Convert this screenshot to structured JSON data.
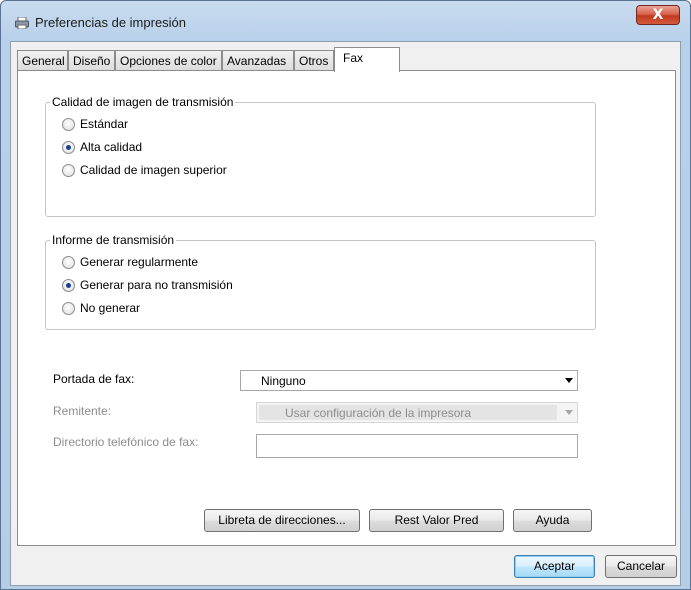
{
  "window": {
    "title": "Preferencias de impresión",
    "close_glyph": "X"
  },
  "tabs": [
    {
      "label": "General"
    },
    {
      "label": "Diseño"
    },
    {
      "label": "Opciones de color"
    },
    {
      "label": "Avanzadas"
    },
    {
      "label": "Otros"
    },
    {
      "label": "Fax"
    }
  ],
  "active_tab": "Fax",
  "quality": {
    "legend": "Calidad de imagen de transmisión",
    "options": [
      {
        "label": "Estándar",
        "checked": false
      },
      {
        "label": "Alta calidad",
        "checked": true
      },
      {
        "label": "Calidad de imagen superior",
        "checked": false
      }
    ]
  },
  "report": {
    "legend": "Informe de transmisión",
    "options": [
      {
        "label": "Generar regularmente",
        "checked": false
      },
      {
        "label": "Generar para no transmisión",
        "checked": true
      },
      {
        "label": "No generar",
        "checked": false
      }
    ]
  },
  "cover": {
    "label": "Portada de fax:",
    "value": "Ninguno"
  },
  "sender": {
    "label": "Remitente:",
    "value": "Usar configuración de la impresora",
    "enabled": false
  },
  "phonebook": {
    "label": "Directorio telefónico de fax:",
    "value": ""
  },
  "buttons": {
    "address_book": "Libreta de direcciones...",
    "reset": "Rest Valor Pred",
    "help": "Ayuda",
    "ok": "Aceptar",
    "cancel": "Cancelar"
  },
  "colors": {
    "title_bar": "#b8d0ea",
    "close_button": "#c1391f",
    "accent": "#1b3f91"
  }
}
